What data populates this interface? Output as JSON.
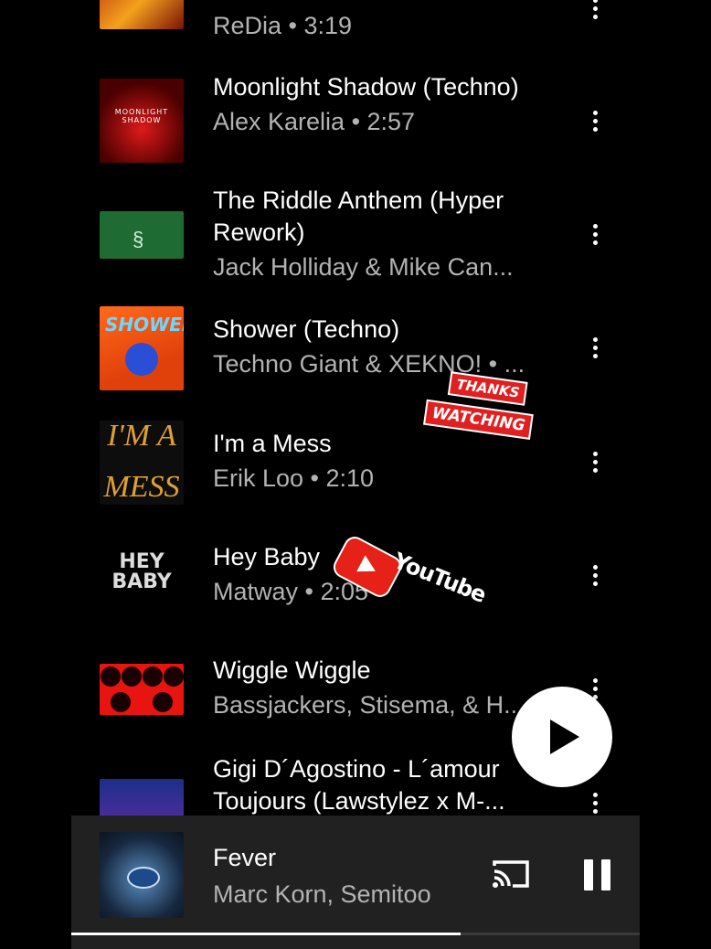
{
  "queue": [
    {
      "title": "",
      "artist_meta": "ReDia • 3:19",
      "thumb_text": ""
    },
    {
      "title": "Moonlight Shadow (Techno)",
      "artist_meta": "Alex Karelia • 2:57",
      "thumb_text": "MOONLIGHT SHADOW"
    },
    {
      "title": "The Riddle Anthem (Hyper Rework)",
      "artist_meta": "Jack Holliday & Mike Can...",
      "thumb_text": ""
    },
    {
      "title": "Shower (Techno)",
      "artist_meta": "Techno Giant & XEKNO! • ...",
      "thumb_text": "SHOWER"
    },
    {
      "title": "I'm a Mess",
      "artist_meta": "Erik Loo • 2:10",
      "thumb_text_top": "I'M A",
      "thumb_text_bottom": "MESS"
    },
    {
      "title": "Hey Baby",
      "artist_meta": "Matway • 2:05",
      "thumb_text": "HEY BABY"
    },
    {
      "title": "Wiggle Wiggle",
      "artist_meta": "Bassjackers, Stisema, & H...",
      "thumb_text": ""
    },
    {
      "title": "Gigi D´Agostino - L´amour Toujours  (Lawstylez x M-...",
      "artist_meta": "",
      "thumb_text": ""
    }
  ],
  "stickers": {
    "thanks_top": "THANKS",
    "thanks_bottom": "WATCHING",
    "youtube_word": "YouTube"
  },
  "now_playing": {
    "title": "Fever",
    "artist": "Marc Korn, Semitoo",
    "progress": 0.685
  },
  "icons": {
    "more": "more-vert-icon",
    "play": "play-icon",
    "cast": "cast-icon",
    "pause": "pause-icon"
  }
}
